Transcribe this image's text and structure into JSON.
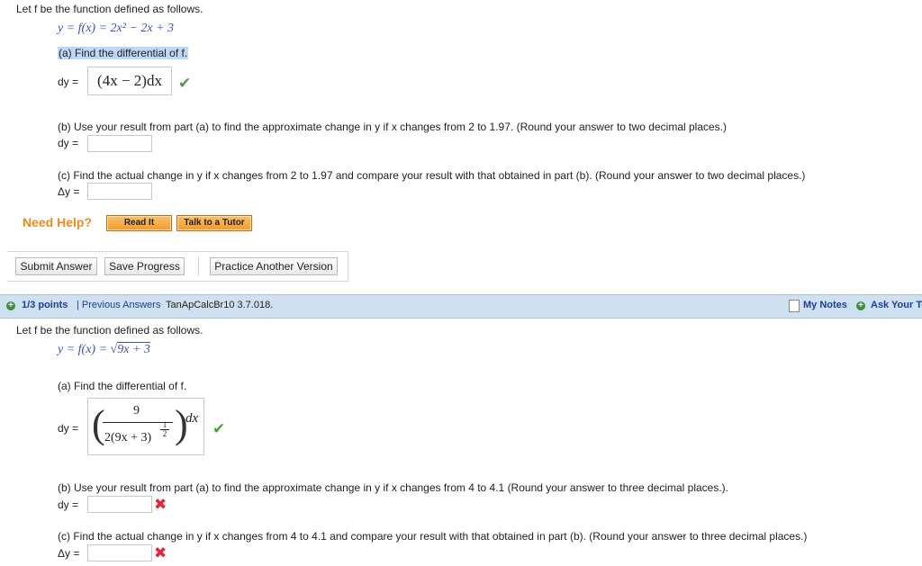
{
  "q1": {
    "intro": "Let f be the function defined as follows.",
    "equation": "y = f(x) = 2x² − 2x + 3",
    "part_a_label": "(a) Find the differential of f.",
    "dy_label": "dy =",
    "part_a_answer": "(4x − 2)dx",
    "part_a_status": "✔",
    "part_b_label": "(b) Use your result from part (a) to find the approximate change in y if x changes from 2 to 1.97. (Round your answer to two decimal places.)",
    "part_b_dy_label": "dy =",
    "part_c_label": "(c) Find the actual change in y if x changes from 2 to 1.97 and compare your result with that obtained in part (b). (Round your answer to two decimal places.)",
    "part_c_dy_label": "Δy =",
    "need_help": "Need Help?",
    "read_it": "Read It",
    "talk_tutor": "Talk to a Tutor",
    "submit": "Submit Answer",
    "save": "Save Progress",
    "practice": "Practice Another Version"
  },
  "q2_header": {
    "points": "1/3 points",
    "previous": "| Previous Answers",
    "code": "TanApCalcBr10 3.7.018.",
    "my_notes": "My Notes",
    "ask": "Ask Your Te"
  },
  "q2": {
    "intro": "Let f be the function defined as follows.",
    "eq_prefix": "y = f(x) = ",
    "eq_radicand": "9x + 3",
    "part_a_label": "(a) Find the differential of f.",
    "dy_label": "dy =",
    "frac_num": "9",
    "frac_den": "2(9x + 3)",
    "exp_num": "1",
    "exp_den": "2",
    "dx": "dx",
    "part_a_status": "✔",
    "part_b_label": "(b) Use your result from part (a) to find the approximate change in y if x changes from 4 to 4.1 (Round your answer to three decimal places.).",
    "part_b_dy_label": "dy =",
    "part_b_status": "✖",
    "part_c_label": "(c) Find the actual change in y if x changes from 4 to 4.1 and compare your result with that obtained in part (b). (Round your answer to three decimal places.)",
    "part_c_dy_label": "Δy =",
    "part_c_status": "✖"
  },
  "colors": {
    "need_help": "#ef8b1c",
    "header_bg": "#cfe0f1",
    "link": "#1d3f95",
    "check": "#4aa33a",
    "cross": "#e0283a"
  }
}
